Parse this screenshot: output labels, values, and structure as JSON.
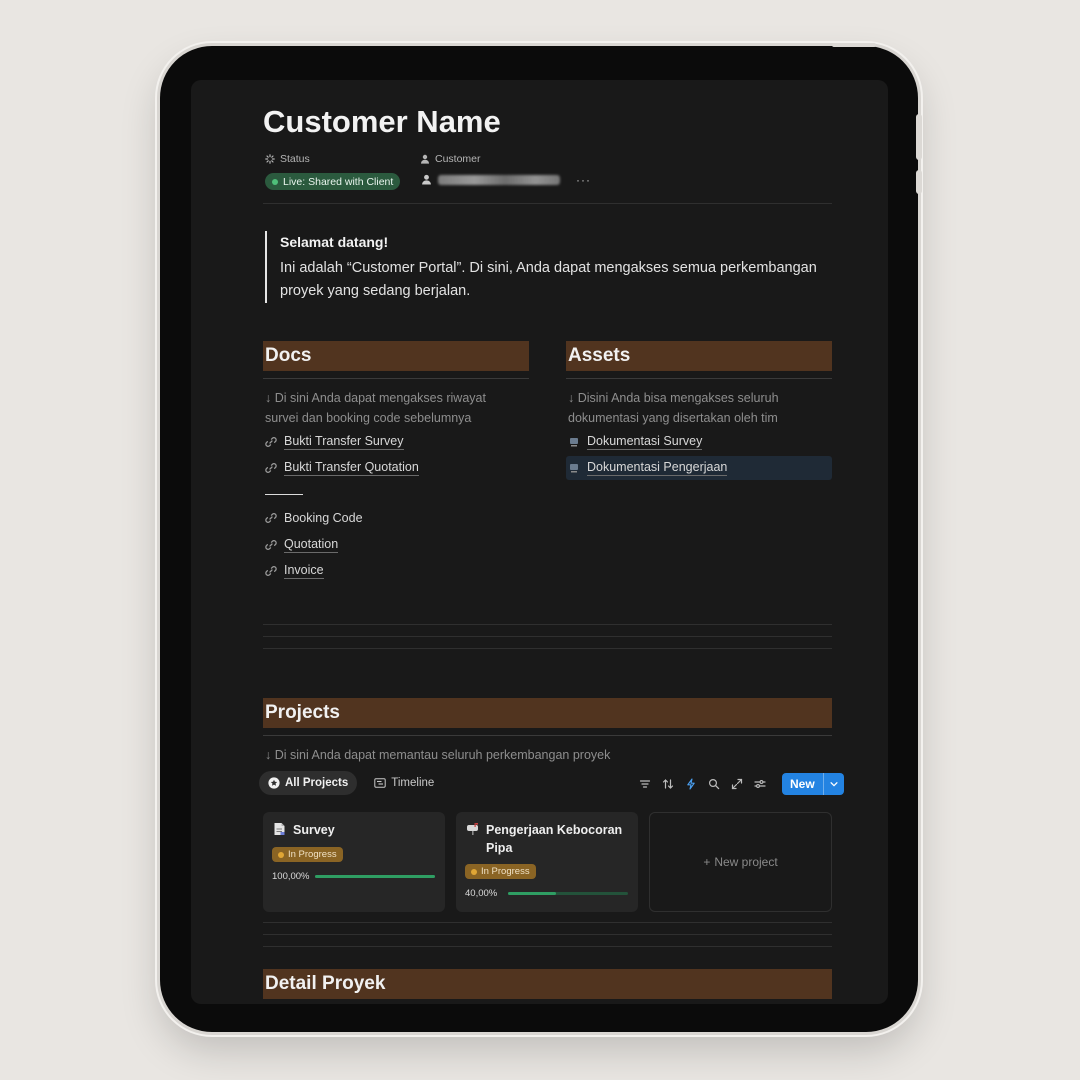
{
  "page": {
    "title": "Customer Name",
    "status_label": "Status",
    "status_value": "Live: Shared with Client",
    "customer_label": "Customer",
    "more": "···"
  },
  "welcome": {
    "heading": "Selamat datang!",
    "body": "Ini adalah “Customer Portal”. Di sini, Anda dapat mengakses semua perkembangan proyek yang sedang berjalan."
  },
  "docs": {
    "heading": "Docs",
    "desc": "↓ Di sini Anda dapat mengakses riwayat survei dan booking code sebelumnya",
    "links_top": [
      "Bukti Transfer Survey",
      "Bukti Transfer Quotation"
    ],
    "links_bottom": [
      "Booking Code",
      "Quotation",
      "Invoice"
    ]
  },
  "assets": {
    "heading": "Assets",
    "desc": "↓ Disini Anda bisa mengakses seluruh dokumentasi yang disertakan oleh tim",
    "links": [
      "Dokumentasi Survey",
      "Dokumentasi Pengerjaan"
    ]
  },
  "projects": {
    "heading": "Projects",
    "desc": "↓ Di sini Anda dapat memantau seluruh perkembangan proyek",
    "tabs": [
      "All Projects",
      "Timeline"
    ],
    "new_label": "New",
    "new_project_label": "New project",
    "cards": [
      {
        "title": "Survey",
        "status": "In Progress",
        "progress_label": "100,00%",
        "progress": 1.0
      },
      {
        "title": "Pengerjaan Kebocoran Pipa",
        "status": "In Progress",
        "progress_label": "40,00%",
        "progress": 0.4
      }
    ]
  },
  "detail": {
    "heading": "Detail Proyek"
  },
  "colors": {
    "background": "#191919",
    "section_header": "#51341f",
    "status_green": "#2b5a3e",
    "badge_orange": "#8a6424",
    "accent_blue": "#2383e2"
  }
}
